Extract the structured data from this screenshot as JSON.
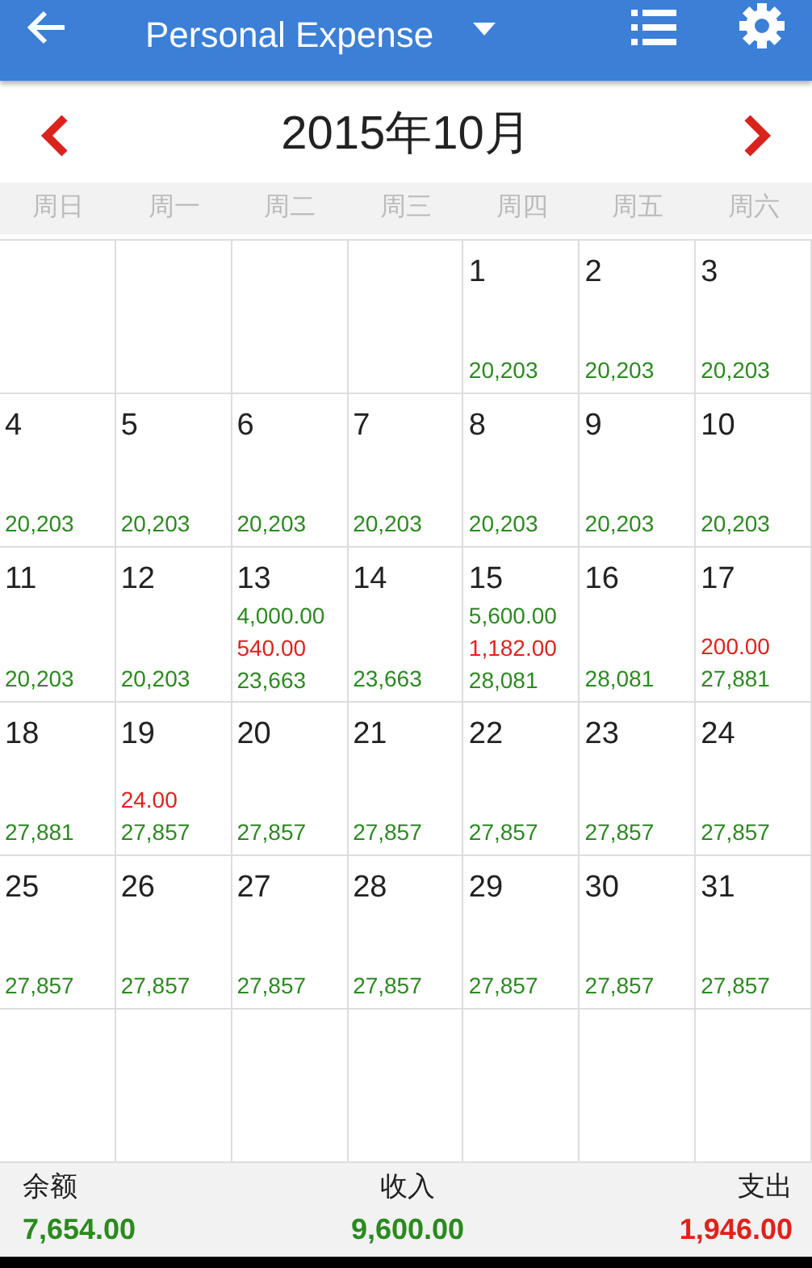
{
  "app_bar": {
    "title": "Personal Expense"
  },
  "month_header": {
    "title": "2015年10月"
  },
  "weekdays": [
    "周日",
    "周一",
    "周二",
    "周三",
    "周四",
    "周五",
    "周六"
  ],
  "weeks": [
    {
      "cells": [
        {
          "kind": "blank"
        },
        {
          "kind": "blank"
        },
        {
          "kind": "blank"
        },
        {
          "kind": "blank"
        },
        {
          "kind": "day",
          "day": "1",
          "balance": "20,203"
        },
        {
          "kind": "day",
          "day": "2",
          "balance": "20,203"
        },
        {
          "kind": "day",
          "day": "3",
          "balance": "20,203"
        }
      ]
    },
    {
      "cells": [
        {
          "kind": "day",
          "day": "4",
          "balance": "20,203"
        },
        {
          "kind": "day",
          "day": "5",
          "balance": "20,203"
        },
        {
          "kind": "day",
          "day": "6",
          "balance": "20,203"
        },
        {
          "kind": "day",
          "day": "7",
          "balance": "20,203"
        },
        {
          "kind": "day",
          "day": "8",
          "balance": "20,203"
        },
        {
          "kind": "day",
          "day": "9",
          "balance": "20,203"
        },
        {
          "kind": "day",
          "day": "10",
          "balance": "20,203"
        }
      ]
    },
    {
      "cells": [
        {
          "kind": "day",
          "day": "11",
          "balance": "20,203"
        },
        {
          "kind": "day",
          "day": "12",
          "balance": "20,203"
        },
        {
          "kind": "day",
          "day": "13",
          "income": "4,000.00",
          "expense": "540.00",
          "balance": "23,663"
        },
        {
          "kind": "day",
          "day": "14",
          "balance": "23,663"
        },
        {
          "kind": "day",
          "day": "15",
          "income": "5,600.00",
          "expense": "1,182.00",
          "balance": "28,081"
        },
        {
          "kind": "day",
          "day": "16",
          "balance": "28,081"
        },
        {
          "kind": "day",
          "day": "17",
          "expense": "200.00",
          "balance": "27,881"
        }
      ]
    },
    {
      "cells": [
        {
          "kind": "day",
          "day": "18",
          "balance": "27,881"
        },
        {
          "kind": "day",
          "day": "19",
          "expense": "24.00",
          "balance": "27,857"
        },
        {
          "kind": "day",
          "day": "20",
          "balance": "27,857"
        },
        {
          "kind": "day",
          "day": "21",
          "balance": "27,857"
        },
        {
          "kind": "day",
          "day": "22",
          "balance": "27,857"
        },
        {
          "kind": "day",
          "day": "23",
          "balance": "27,857"
        },
        {
          "kind": "day",
          "day": "24",
          "balance": "27,857"
        }
      ]
    },
    {
      "cells": [
        {
          "kind": "day",
          "day": "25",
          "balance": "27,857"
        },
        {
          "kind": "day",
          "day": "26",
          "balance": "27,857"
        },
        {
          "kind": "day",
          "day": "27",
          "balance": "27,857"
        },
        {
          "kind": "day",
          "day": "28",
          "balance": "27,857"
        },
        {
          "kind": "day",
          "day": "29",
          "balance": "27,857"
        },
        {
          "kind": "day",
          "day": "30",
          "balance": "27,857"
        },
        {
          "kind": "day",
          "day": "31",
          "balance": "27,857"
        }
      ]
    },
    {
      "cells": [
        {
          "kind": "blank"
        },
        {
          "kind": "blank"
        },
        {
          "kind": "blank"
        },
        {
          "kind": "blank"
        },
        {
          "kind": "blank"
        },
        {
          "kind": "blank"
        },
        {
          "kind": "blank"
        }
      ]
    }
  ],
  "summary": [
    {
      "kind": "balance",
      "label": "余额",
      "value": "7,654.00"
    },
    {
      "kind": "income",
      "label": "收入",
      "value": "9,600.00"
    },
    {
      "kind": "expense",
      "label": "支出",
      "value": "1,946.00"
    }
  ]
}
